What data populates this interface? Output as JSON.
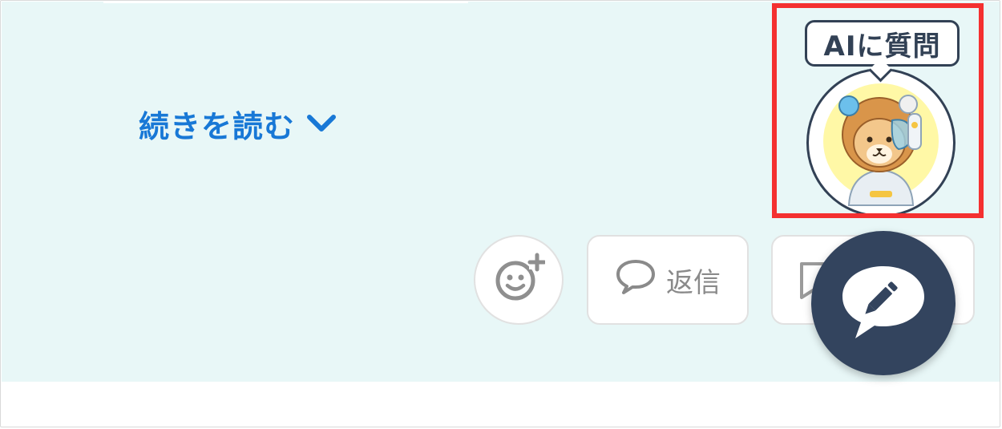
{
  "post": {
    "read_more_label": "続きを読む",
    "read_more_icon": "chevron-down-icon"
  },
  "ai_assistant": {
    "label": "AIに質問",
    "mascot": "lion-robot-mascot"
  },
  "actions": {
    "reaction_icon": "add-reaction-icon",
    "reply_label": "返信",
    "reply_icon": "speech-bubble-icon",
    "bookmark_icon": "bookmark-icon",
    "compose_icon": "compose-pencil-icon"
  },
  "colors": {
    "content_bg": "#e8f7f7",
    "link_blue": "#1878d6",
    "fab_navy": "#33445e",
    "highlight_red": "#f43030"
  }
}
